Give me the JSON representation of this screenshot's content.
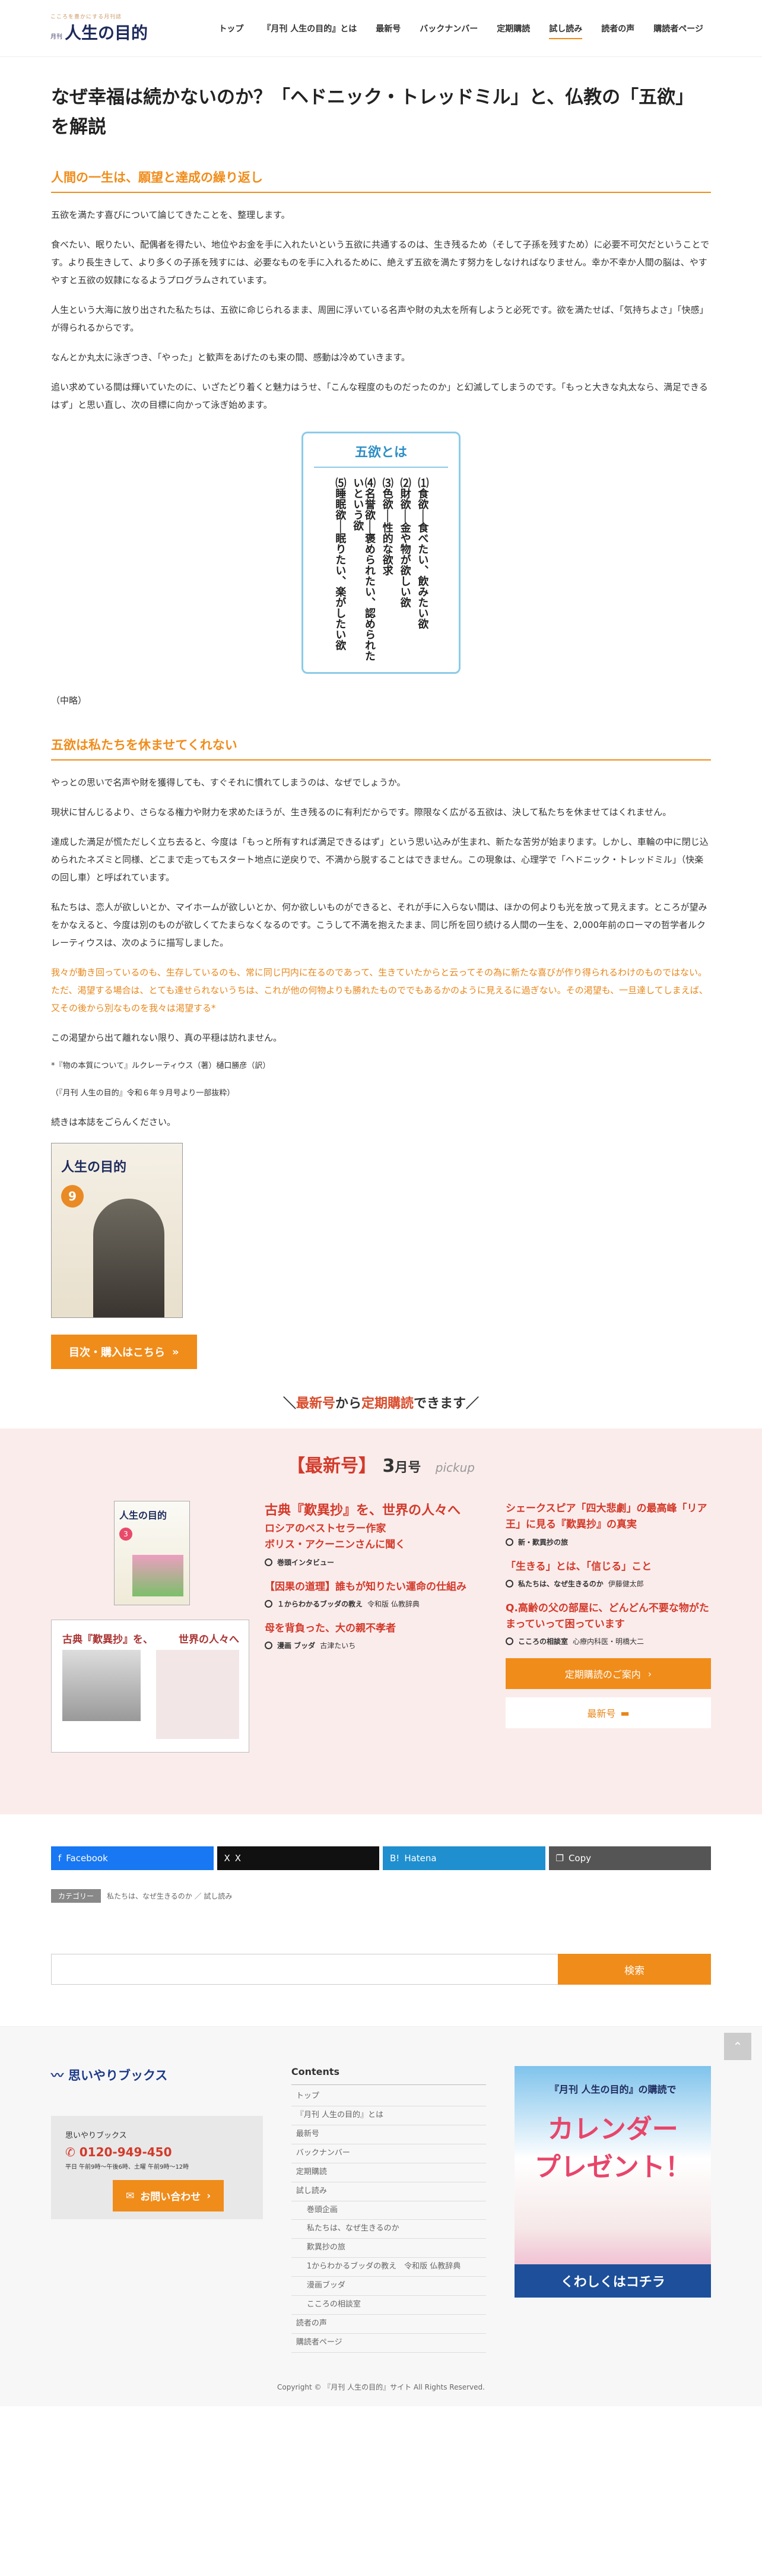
{
  "header": {
    "logo_tagline": "こころを豊かにする月刊誌",
    "logo_small": "月刊",
    "logo_main": "人生の目的",
    "nav": [
      "トップ",
      "『月刊 人生の目的』とは",
      "最新号",
      "バックナンバー",
      "定期購読",
      "試し読み",
      "読者の声",
      "購読者ページ"
    ],
    "active_index": 5
  },
  "article": {
    "title": "なぜ幸福は続かないのか？「ヘドニック・トレッドミル」と、仏教の「五欲」を解説",
    "h2_1": "人間の一生は、願望と達成の繰り返し",
    "p1": "五欲を満たす喜びについて論じてきたことを、整理します。",
    "p2": "食べたい、眠りたい、配偶者を得たい、地位やお金を手に入れたいという五欲に共通するのは、生き残るため（そして子孫を残すため）に必要不可欠だということです。より長生きして、より多くの子孫を残すには、必要なものを手に入れるために、絶えず五欲を満たす努力をしなければなりません。幸か不幸か人間の脳は、やすやすと五欲の奴隷になるようプログラムされています。",
    "p3": "人生という大海に放り出された私たちは、五欲に命じられるまま、周囲に浮いている名声や財の丸太を所有しようと必死です。欲を満たせば、「気持ちよさ」「快感」が得られるからです。",
    "p4": "なんとか丸太に泳ぎつき、「やった」と歓声をあげたのも束の間、感動は冷めていきます。",
    "p5": "追い求めている間は輝いていたのに、いざたどり着くと魅力はうせ、「こんな程度のものだったのか」と幻滅してしまうのです。「もっと大きな丸太なら、満足できるはず」と思い直し、次の目標に向かって泳ぎ始めます。",
    "gokyoku_title": "五欲とは",
    "gokyoku": [
      "⑴食欲──食べたい、飲みたい欲",
      "⑵財欲──金や物が欲しい欲",
      "⑶色欲──性的な欲求",
      "⑷名誉欲──褒められたい、認められたいという欲",
      "⑸睡眠欲──眠りたい、楽がしたい欲"
    ],
    "omit": "（中略）",
    "h2_2": "五欲は私たちを休ませてくれない",
    "p6": "やっとの思いで名声や財を獲得しても、すぐそれに慣れてしまうのは、なぜでしょうか。",
    "p7": "現状に甘んじるより、さらなる権力や財力を求めたほうが、生き残るのに有利だからです。際限なく広がる五欲は、決して私たちを休ませてはくれません。",
    "p8": "達成した満足が慌ただしく立ち去ると、今度は「もっと所有すれば満足できるはず」という思い込みが生まれ、新たな苦労が始まります。しかし、車輪の中に閉じ込められたネズミと同様、どこまで走ってもスタート地点に逆戻りで、不満から脱することはできません。この現象は、心理学で「ヘドニック・トレッドミル」（快楽の回し車）と呼ばれています。",
    "p9": "私たちは、恋人が欲しいとか、マイホームが欲しいとか、何か欲しいものができると、それが手に入らない間は、ほかの何よりも光を放って見えます。ところが望みをかなえると、今度は別のものが欲しくてたまらなくなるのです。こうして不満を抱えたまま、同じ所を回り続ける人間の一生を、2,000年前のローマの哲学者ルクレーティウスは、次のように描写しました。",
    "quote": "我々が動き回っているのも、生存しているのも、常に同じ円内に在るのであって、生きていたからと云ってその為に新たな喜びが作り得られるわけのものではない。ただ、渇望する場合は、とても達せられないうちは、これが他の何物よりも勝れたものででもあるかのように見えるに過ぎない。その渇望も、一旦達してしまえば、又その後から別なものを我々は渇望する*",
    "p10": "この渇望から出て離れない限り、真の平穏は訪れません。",
    "note": "*『物の本質について』ルクレーティウス（著）樋口勝彦（訳）",
    "source": "（『月刊 人生の目的』令和６年９月号より一部抜粋）",
    "continue": "続きは本誌をごらんください。",
    "cover_title": "人生の目的",
    "cover_num": "9",
    "buy_button": "目次・購入はこちら"
  },
  "teiki": {
    "prefix": "＼",
    "a": "最新号",
    "mid": "から",
    "b": "定期購読",
    "suffix": "できます／"
  },
  "latest": {
    "label": "【最新号】",
    "month_num": "3",
    "month_unit": "月号",
    "pickup": "pickup",
    "cover_title": "人生の目的",
    "cover_num": "3",
    "spread_left": "古典『歎異抄』を、",
    "spread_right": "世界の人々へ",
    "main_title": "古典『歎異抄』を、世界の人々へ",
    "main_sub": "ロシアのベストセラー作家\nボリス・アクーニンさんに聞く",
    "main_meta": "巻頭インタビュー",
    "mid_title": "【因果の道理】誰もが知りたい運命の仕組み",
    "mid_meta_a": "１からわかるブッダの教え",
    "mid_meta_b": "令和版 仏教辞典",
    "low_title": "母を背負った、大の親不孝者",
    "low_meta_a": "漫画 ブッダ",
    "low_meta_b": "古津たいち",
    "r1_title": "シェークスピア「四大悲劇」の最高峰「リア王」に見る『歎異抄』の真実",
    "r1_meta": "新・歎異抄の旅",
    "r2_title": "「生きる」とは、「信じる」こと",
    "r2_meta_a": "私たちは、なぜ生きるのか",
    "r2_meta_b": "伊藤健太郎",
    "r3_title": "Q.高齢の父の部屋に、どんどん不要な物がたまっていって困っています",
    "r3_meta_a": "こころの相談室",
    "r3_meta_b": "心療内科医・明橋大二",
    "btn_teiki": "定期購読のご案内",
    "btn_latest": "最新号"
  },
  "share": [
    {
      "label": "Facebook",
      "color": "#1877f2",
      "icon": "f"
    },
    {
      "label": "X",
      "color": "#111111",
      "icon": "X"
    },
    {
      "label": "Hatena",
      "color": "#1f8fcf",
      "icon": "B!"
    },
    {
      "label": "Copy",
      "color": "#555555",
      "icon": "❐"
    }
  ],
  "crumb": {
    "tag": "カテゴリー",
    "path": "私たちは、なぜ生きるのか ／ 試し読み"
  },
  "search": {
    "placeholder": "",
    "button": "検索"
  },
  "footer": {
    "logo": "思いやりブックス",
    "box_name": "思いやりブックス",
    "tel": "0120-949-450",
    "hours": "平日 午前9時〜午後6時、土曜 午前9時〜12時",
    "contact": "お問い合わせ",
    "contents_title": "Contents",
    "links": [
      {
        "t": "トップ",
        "sub": false
      },
      {
        "t": "『月刊 人生の目的』とは",
        "sub": false
      },
      {
        "t": "最新号",
        "sub": false
      },
      {
        "t": "バックナンバー",
        "sub": false
      },
      {
        "t": "定期購読",
        "sub": false
      },
      {
        "t": "試し読み",
        "sub": false
      },
      {
        "t": "巻頭企画",
        "sub": true
      },
      {
        "t": "私たちは、なぜ生きるのか",
        "sub": true
      },
      {
        "t": "歎異抄の旅",
        "sub": true
      },
      {
        "t": "1からわかるブッダの教え　令和版 仏教辞典",
        "sub": true
      },
      {
        "t": "漫画ブッダ",
        "sub": true
      },
      {
        "t": "こころの相談室",
        "sub": true
      },
      {
        "t": "読者の声",
        "sub": false
      },
      {
        "t": "購読者ページ",
        "sub": false
      }
    ],
    "banner_top": "『月刊 人生の目的』の購読で",
    "banner_main": "カレンダー\nプレゼント！",
    "banner_btn": "くわしくはコチラ",
    "copyright": "Copyright © 『月刊 人生の目的』サイト All Rights Reserved."
  }
}
